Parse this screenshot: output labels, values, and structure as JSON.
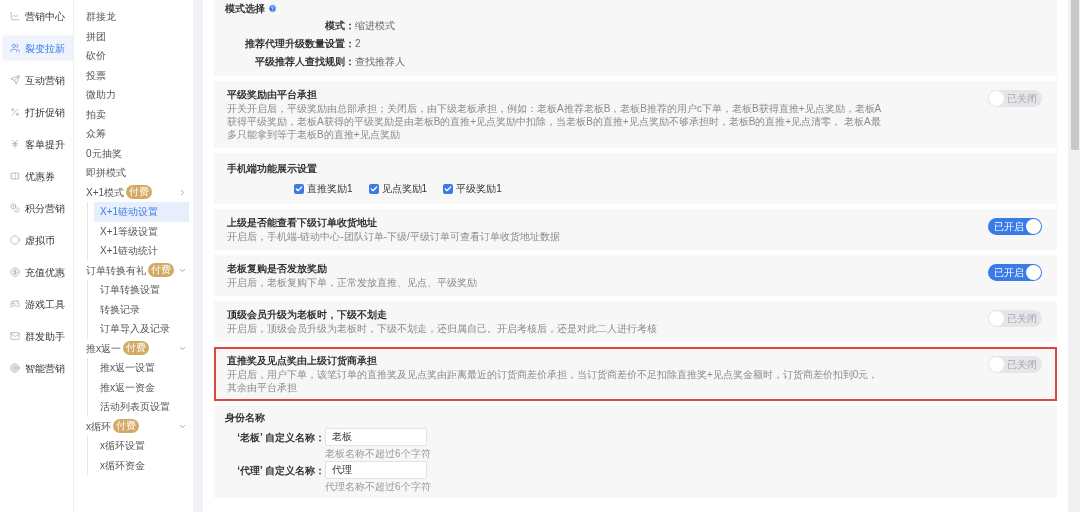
{
  "sidebar": {
    "items": [
      {
        "label": "营销中心",
        "selected": false
      },
      {
        "label": "裂变拉新",
        "selected": true
      },
      {
        "label": "互动营销",
        "selected": false
      },
      {
        "label": "打折促销",
        "selected": false
      },
      {
        "label": "客单提升",
        "selected": false
      },
      {
        "label": "优惠券",
        "selected": false
      },
      {
        "label": "积分营销",
        "selected": false
      },
      {
        "label": "虚拟币",
        "selected": false
      },
      {
        "label": "充值优惠",
        "selected": false
      },
      {
        "label": "游戏工具",
        "selected": false
      },
      {
        "label": "群发助手",
        "selected": false
      },
      {
        "label": "智能营销",
        "selected": false
      }
    ]
  },
  "submenu": {
    "items": [
      {
        "label": "群接龙"
      },
      {
        "label": "拼团"
      },
      {
        "label": "砍价"
      },
      {
        "label": "投票"
      },
      {
        "label": "微助力"
      },
      {
        "label": "拍卖"
      },
      {
        "label": "众筹"
      },
      {
        "label": "0元抽奖"
      },
      {
        "label": "即拼模式"
      },
      {
        "label": "X+1模式",
        "badge": "付费",
        "expanded": false,
        "children": [
          {
            "label": "X+1链动设置",
            "selected": true
          },
          {
            "label": "X+1等级设置",
            "selected": false
          },
          {
            "label": "X+1链动统计",
            "selected": false
          }
        ]
      },
      {
        "label": "订单转换有礼",
        "badge": "付费",
        "expanded": true,
        "children": [
          {
            "label": "订单转换设置",
            "selected": false
          },
          {
            "label": "转换记录",
            "selected": false
          },
          {
            "label": "订单导入及记录",
            "selected": false
          }
        ]
      },
      {
        "label": "推x返一",
        "badge": "付费",
        "expanded": true,
        "children": [
          {
            "label": "推x返一设置",
            "selected": false
          },
          {
            "label": "推x返一资金",
            "selected": false
          },
          {
            "label": "活动列表页设置",
            "selected": false
          }
        ]
      },
      {
        "label": "x循环",
        "badge": "付费",
        "expanded": true,
        "children": [
          {
            "label": "x循环设置",
            "selected": false
          },
          {
            "label": "x循环资金",
            "selected": false
          }
        ]
      }
    ]
  },
  "mode_section": {
    "title": "模式选择",
    "fields": [
      {
        "label": "模式：",
        "value": "缩进模式"
      },
      {
        "label": "推荐代理升级数量设置：",
        "value": "2"
      },
      {
        "label": "平级推荐人查找规则：",
        "value": "查找推荐人"
      }
    ]
  },
  "settings": [
    {
      "kind": "toggle",
      "title": "平级奖励由平台承担",
      "description": "开关开启后，平级奖励由总部承担；关闭后，由下级老板承担，例如：老板A推荐老板B，老板B推荐的用户c下单，老板B获得直推+见点奖励，老板A获得平级奖励，老板A获得的平级奖励是由老板B的直推+见点奖励中扣除，当老板B的直推+见点奖励不够承担时，老板B的直推+见点清零， 老板A最多只能拿到等于老板B的直推+见点奖励",
      "on": false,
      "toggle_label": "已关闭",
      "highlighted": false
    },
    {
      "kind": "checkboxes",
      "title": "手机端功能展示设置",
      "options": [
        {
          "label": "直推奖励1",
          "checked": true
        },
        {
          "label": "见点奖励1",
          "checked": true
        },
        {
          "label": "平级奖励1",
          "checked": true
        }
      ]
    },
    {
      "kind": "toggle",
      "title": "上级是否能查看下级订单收货地址",
      "description": "开启后，手机端-链动中心-团队订单-下级/平级订单可查看订单收货地址数据",
      "on": true,
      "toggle_label": "已开启",
      "highlighted": false
    },
    {
      "kind": "toggle",
      "title": "老板复购是否发放奖励",
      "description": "开启后，老板复购下单，正常发放直推、见点、平级奖励",
      "on": true,
      "toggle_label": "已开启",
      "highlighted": false
    },
    {
      "kind": "toggle",
      "title": "顶级会员升级为老板时，下级不划走",
      "description": "开启后，顶级会员升级为老板时，下级不划走，还归属自己。开启考核后，还是对此二人进行考核",
      "on": false,
      "toggle_label": "已关闭",
      "highlighted": false
    },
    {
      "kind": "toggle",
      "title": "直推奖及见点奖由上级订货商承担",
      "description": "开启后，用户下单，该笔订单的直推奖及见点奖由距离最近的订货商差价承担，当订货商差价不足扣除直推奖+见点奖金额时，订货商差价扣到0元，其余由平台承担",
      "on": false,
      "toggle_label": "已关闭",
      "highlighted": true
    }
  ],
  "identity_section": {
    "title": "身份名称",
    "fields": [
      {
        "label": "‘老板’ 自定义名称：",
        "value": "老板",
        "hint": "老板名称不超过6个字符"
      },
      {
        "label": "‘代理’ 自定义名称：",
        "value": "代理",
        "hint": "代理名称不超过6个字符"
      }
    ]
  }
}
